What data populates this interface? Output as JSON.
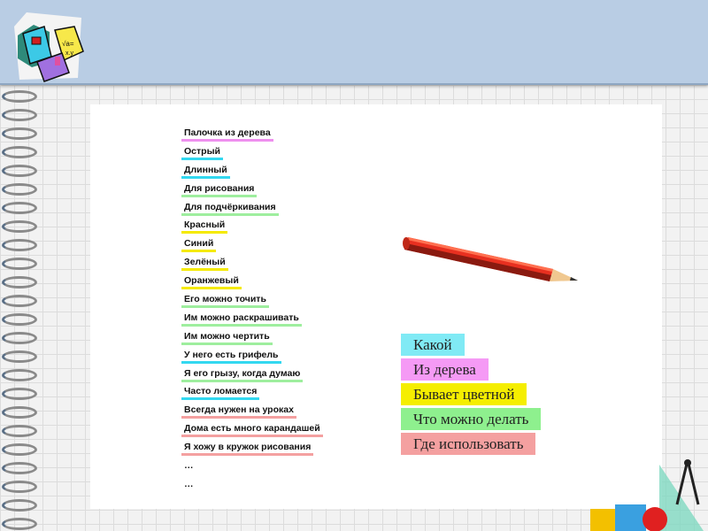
{
  "list": [
    {
      "text": "Палочка из дерева",
      "color": "#ee90ee"
    },
    {
      "text": "Острый",
      "color": "#33d8f0"
    },
    {
      "text": "Длинный",
      "color": "#33d8f0"
    },
    {
      "text": "Для рисования",
      "color": "#9eee9e"
    },
    {
      "text": "Для подчёркивания",
      "color": "#9eee9e"
    },
    {
      "text": "Красный",
      "color": "#f5ea00"
    },
    {
      "text": "Синий",
      "color": "#f5ea00"
    },
    {
      "text": "Зелёный",
      "color": "#f5ea00"
    },
    {
      "text": "Оранжевый",
      "color": "#f5ea00"
    },
    {
      "text": "Его можно точить",
      "color": "#9eee9e"
    },
    {
      "text": "Им можно раскрашивать",
      "color": "#9eee9e"
    },
    {
      "text": "Им можно чертить",
      "color": "#9eee9e"
    },
    {
      "text": "У него есть грифель",
      "color": "#33d8f0"
    },
    {
      "text": "Я его грызу, когда думаю",
      "color": "#9eee9e"
    },
    {
      "text": "Часто ломается",
      "color": "#33d8f0"
    },
    {
      "text": "Всегда нужен на уроках",
      "color": "#f4a0a0"
    },
    {
      "text": "Дома есть много карандашей",
      "color": "#f4a0a0"
    },
    {
      "text": "Я хожу в кружок рисования",
      "color": "#f4a0a0"
    },
    {
      "text": "…",
      "color": ""
    },
    {
      "text": "…",
      "color": ""
    }
  ],
  "categories": [
    {
      "text": "Какой",
      "color": "#80eaf5"
    },
    {
      "text": "Из дерева",
      "color": "#f59af5"
    },
    {
      "text": "Бывает цветной",
      "color": "#f5ee00"
    },
    {
      "text": "Что можно делать",
      "color": "#8ef08e"
    },
    {
      "text": "Где использовать",
      "color": "#f4a0a0"
    }
  ]
}
